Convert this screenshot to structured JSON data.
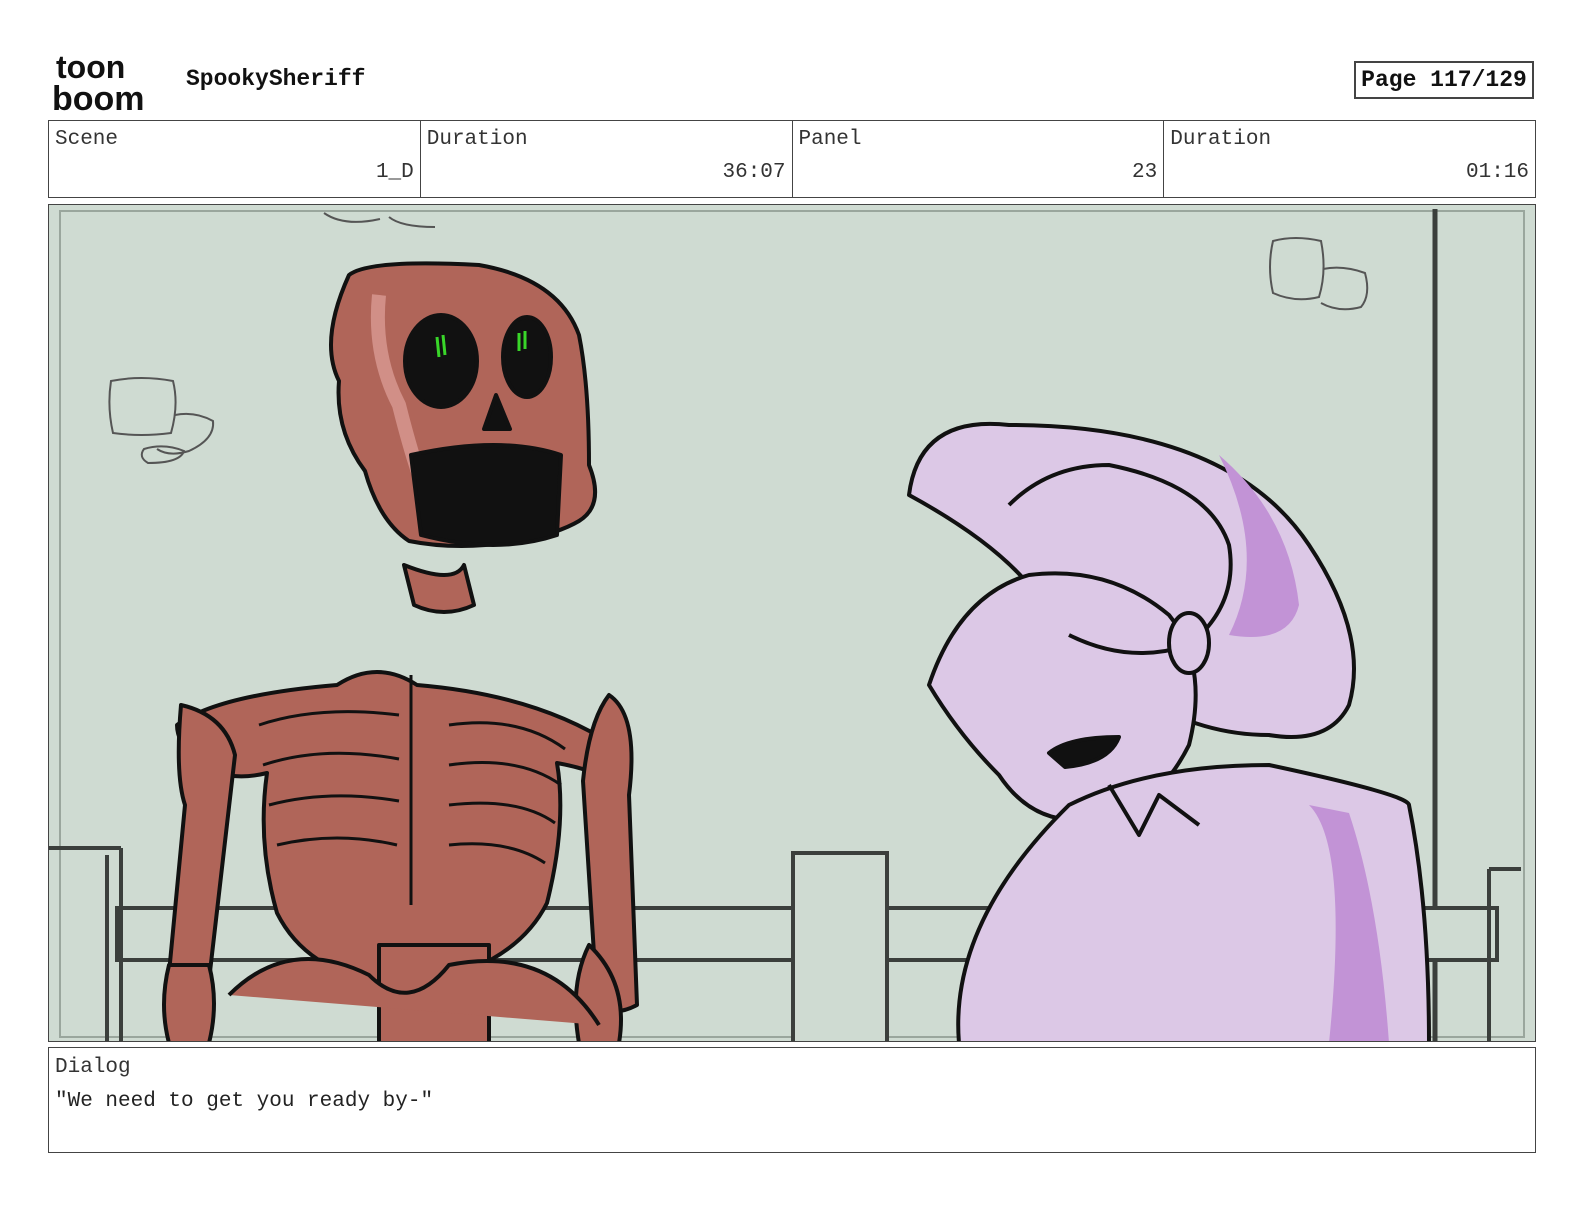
{
  "brand": {
    "logo_line1": "toon",
    "logo_line2": "boom"
  },
  "header": {
    "project_title": "SpookySheriff",
    "page_indicator": "Page 117/129"
  },
  "info": [
    {
      "label": "Scene",
      "value": "1_D"
    },
    {
      "label": "Duration",
      "value": "36:07"
    },
    {
      "label": "Panel",
      "value": "23"
    },
    {
      "label": "Duration",
      "value": "01:16"
    }
  ],
  "dialog": {
    "label": "Dialog",
    "text": "\"We need to get you ready by-\""
  },
  "colors": {
    "wall": "#cfdbd2",
    "skeleton": "#b06559",
    "skeleton_highlight": "#d18f87",
    "sheriff": "#dcc8e6",
    "sheriff_shadow": "#c293d6",
    "eye_glow": "#39d629"
  }
}
